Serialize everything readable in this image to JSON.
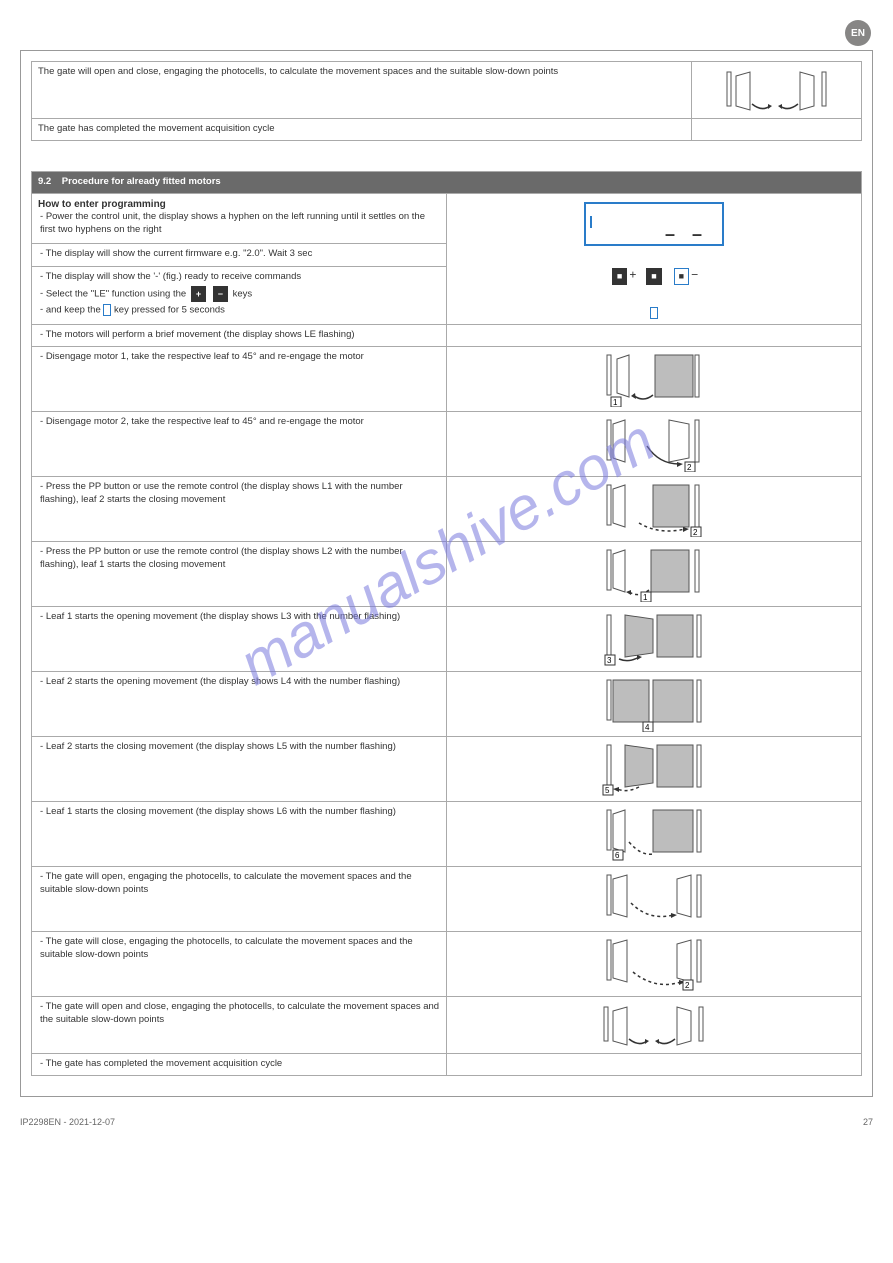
{
  "lang_code": "EN",
  "top": {
    "row1_left": "The gate will open and close, engaging the photocells, to calculate the movement spaces and the suitable slow-down points",
    "row2_left": "The gate has completed the movement acquisition cycle"
  },
  "section": {
    "number": "9.2",
    "title": "Procedure for already fitted motors"
  },
  "r0": {
    "title": "How to enter programming",
    "step1": "Power the control unit, the display shows a hyphen on the left running until it settles on the first two hyphens on the right"
  },
  "r1": "The display will show the current firmware e.g. \"2.0\". Wait 3 sec",
  "r2": {
    "line1": "The display will show the '-' (fig.) ready to receive commands",
    "line2_pre": "Select the \"LE\" function using the",
    "line2_post": "keys",
    "line3_pre": "and keep the",
    "line3_post": "key pressed for 5 seconds"
  },
  "r3": "The motors will perform a brief movement (the display shows LE flashing)",
  "r4": "Disengage motor 1, take the respective leaf to 45° and re-engage the motor",
  "r5": "Disengage motor 2, take the respective leaf to 45° and re-engage the motor",
  "r6": "Press the PP button or use the remote control (the display shows L1 with the number flashing), leaf 2 starts the closing movement",
  "r7": "Press the PP button or use the remote control (the display shows L2 with the number flashing), leaf 1 starts the closing movement",
  "r8": "Leaf 1 starts the opening movement (the display shows L3 with the number flashing)",
  "r9": "Leaf 2 starts the opening movement (the display shows L4 with the number flashing)",
  "r10": "Leaf 2 starts the closing movement (the display shows L5 with the number flashing)",
  "r11": "Leaf 1 starts the closing movement (the display shows L6 with the number flashing)",
  "r12": "The gate will open, engaging the photocells, to calculate the movement spaces and the suitable slow-down points",
  "r13": "The gate will close, engaging the photocells, to calculate the movement spaces and the suitable slow-down points",
  "r14": "The gate will open and close, engaging the photocells, to calculate the movement spaces and the suitable slow-down points",
  "r15": "The gate has completed the movement acquisition cycle",
  "labels": {
    "num1": "1",
    "num2": "2",
    "num3": "3",
    "num4": "4",
    "num5": "5",
    "num6": "6"
  },
  "footer": "IP2298EN - 2021-12-07",
  "watermark": "manualshive.com",
  "pageno": "27"
}
